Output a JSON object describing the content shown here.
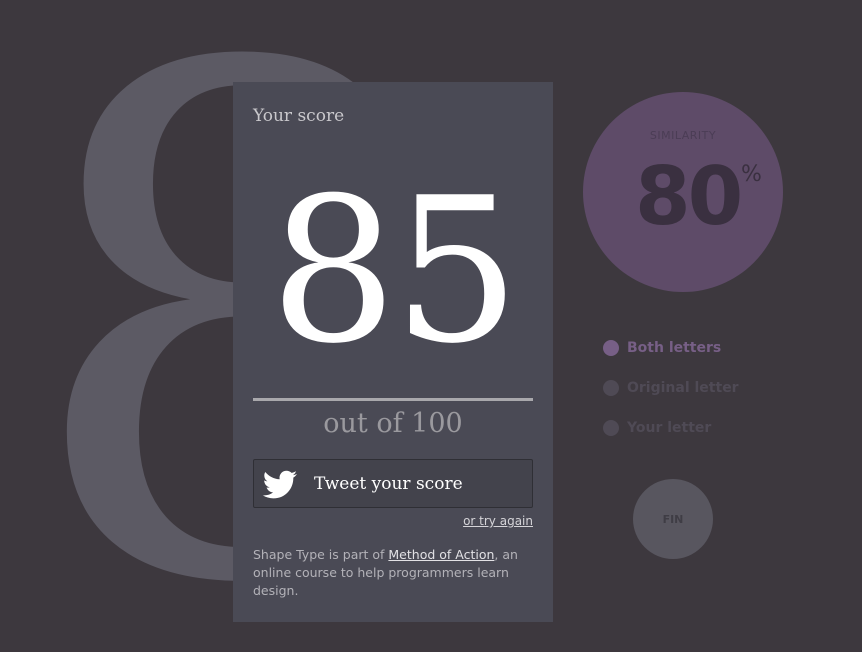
{
  "background": {
    "glyph": "8",
    "color": "#3d383e",
    "glyph_color": "#5c5a64"
  },
  "score_panel": {
    "title": "Your score",
    "score": "85",
    "out_of": "out of 100",
    "tweet_label": "Tweet your score",
    "tweet_icon": "twitter-bird-icon",
    "try_again": "or try again",
    "footer_prefix": "Shape Type is part of ",
    "footer_link": "Method of Action",
    "footer_suffix": ", an online course to help programmers learn design."
  },
  "similarity": {
    "label": "SIMILARITY",
    "value": "80",
    "unit": "%",
    "color": "#5e4b68"
  },
  "legend": {
    "items": [
      {
        "label": "Both letters",
        "color": "#775f86",
        "dot_color": "#775f86"
      },
      {
        "label": "Original letter",
        "color": "#4f4a55",
        "dot_color": "#4f4a55"
      },
      {
        "label": "Your letter",
        "color": "#4f4a55",
        "dot_color": "#4f4a55"
      }
    ]
  },
  "fin_button": {
    "label": "FIN"
  }
}
